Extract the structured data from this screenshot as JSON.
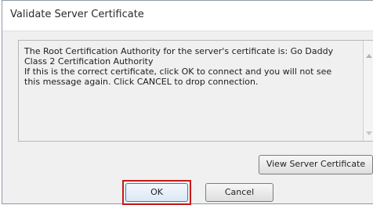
{
  "window": {
    "title": "Validate Server Certificate"
  },
  "message": {
    "text": "The Root Certification Authority for the server's certificate is: Go Daddy\nClass 2 Certification Authority\nIf this is the correct certificate, click OK to connect and you will not see\nthis message again.  Click CANCEL to drop connection."
  },
  "buttons": {
    "view_certificate": "View Server Certificate",
    "ok": "OK",
    "cancel": "Cancel"
  },
  "colors": {
    "highlight_border": "#c61a1a"
  },
  "icons": {
    "scroll_up": "scroll-up-arrow-icon",
    "scroll_down": "scroll-down-arrow-icon"
  }
}
